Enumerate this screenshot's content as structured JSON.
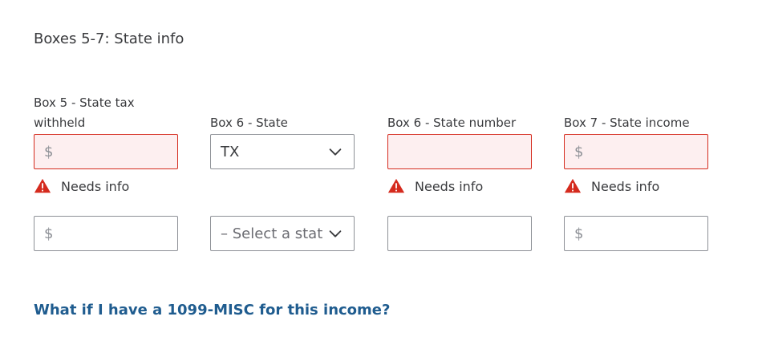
{
  "section": {
    "title": "Boxes 5-7: State info"
  },
  "columns": [
    {
      "label": "Box 5 - State tax withheld",
      "row1": {
        "prefix": "$",
        "error": true
      },
      "row2": {
        "prefix": "$"
      }
    },
    {
      "label": "Box 6 - State",
      "row1": {
        "value": "TX"
      },
      "row2": {
        "placeholder": "– Select a stat"
      }
    },
    {
      "label": "Box 6 - State number",
      "row1": {
        "error": true
      },
      "row2": {}
    },
    {
      "label": "Box 7 - State income",
      "row1": {
        "prefix": "$",
        "error": true
      },
      "row2": {
        "prefix": "$"
      }
    }
  ],
  "error_text": "Needs info",
  "link_text": "What if I have a 1099-MISC for this income?",
  "colors": {
    "error": "#d52b1e",
    "error_bg": "#fdeff0",
    "link": "#1f5c8f",
    "border": "#8d9096"
  },
  "icons": {
    "error": "warning-icon",
    "dropdown": "chevron-down-icon"
  }
}
